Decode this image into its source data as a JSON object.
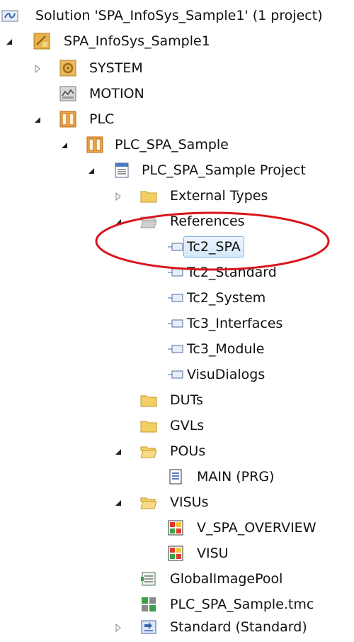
{
  "tree": {
    "solution": "Solution 'SPA_InfoSys_Sample1' (1 project)",
    "project": "SPA_InfoSys_Sample1",
    "system": "SYSTEM",
    "motion": "MOTION",
    "plc": "PLC",
    "plc_project": "PLC_SPA_Sample",
    "plc_project_inner": "PLC_SPA_Sample Project",
    "external_types": "External Types",
    "references": "References",
    "ref_items": [
      "Tc2_SPA",
      "Tc2_Standard",
      "Tc2_System",
      "Tc3_Interfaces",
      "Tc3_Module",
      "VisuDialogs"
    ],
    "duts": "DUTs",
    "gvls": "GVLs",
    "pous": "POUs",
    "main": "MAIN (PRG)",
    "visus": "VISUs",
    "v_overview": "V_SPA_OVERVIEW",
    "visu": "VISU",
    "global_image_pool": "GlobalImagePool",
    "tmc": "PLC_SPA_Sample.tmc",
    "standard": "Standard (Standard)"
  },
  "colors": {
    "folder": "#f3cf63",
    "annotation": "#d9141b",
    "selection": "#7eb4ea"
  }
}
